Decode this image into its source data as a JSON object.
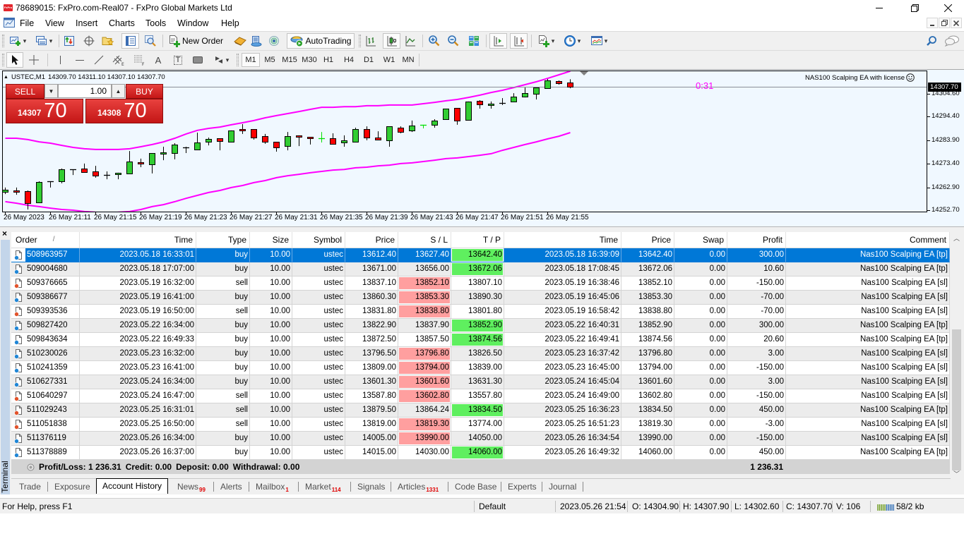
{
  "window": {
    "title": "78689015: FxPro.com-Real07 - FxPro Global Markets Ltd",
    "app_icon_text": "FxPro"
  },
  "menu": [
    "File",
    "View",
    "Insert",
    "Charts",
    "Tools",
    "Window",
    "Help"
  ],
  "toolbar": {
    "new_order": "New Order",
    "autotrading": "AutoTrading",
    "timeframes": [
      "M1",
      "M5",
      "M15",
      "M30",
      "H1",
      "H4",
      "D1",
      "W1",
      "MN"
    ],
    "active_timeframe": "M1",
    "drawing_text_tool": "A",
    "drawing_label_tool": "T"
  },
  "chart": {
    "symbol_header": "USTEC,M1",
    "ohlc_header": "14309.70 14311.10 14307.10 14307.70",
    "ea_label": "NAS100 Scalping EA with license",
    "ea_status_icon": "smiley-icon",
    "bar_timer": "0:31",
    "bid": 14307.7,
    "bid_label": "14307.70",
    "price_range": [
      14252.07,
      14314.68
    ],
    "price_ticks": [
      "14304.60",
      "14294.40",
      "14283.90",
      "14273.40",
      "14262.90",
      "14252.70"
    ],
    "time_label_every": 4,
    "time_labels": [
      "26 May 2023",
      "26 May 21:11",
      "26 May 21:15",
      "26 May 21:19",
      "26 May 21:23",
      "26 May 21:27",
      "26 May 21:31",
      "26 May 21:35",
      "26 May 21:39",
      "26 May 21:43",
      "26 May 21:47",
      "26 May 21:51",
      "26 May 21:55"
    ],
    "colors": {
      "bull": "#32cd32",
      "bear": "#ff0000",
      "doji_up": "#00e000",
      "band": "#ff00ff",
      "bid_line": "#8a8f96"
    },
    "candles": [
      [
        14260.9,
        14262.8,
        14259.9,
        14261.8
      ],
      [
        14261.5,
        14262.8,
        14259.6,
        14260.9
      ],
      [
        14261.2,
        14261.5,
        14253.0,
        14255.9
      ],
      [
        14256.2,
        14265.6,
        14255.9,
        14265.3
      ],
      [
        14265.6,
        14265.6,
        14262.8,
        14265.6
      ],
      [
        14265.6,
        14271.3,
        14264.7,
        14270.9
      ],
      [
        14270.9,
        14270.9,
        14268.4,
        14270.9
      ],
      [
        14271.3,
        14273.5,
        14269.4,
        14269.7
      ],
      [
        14270.0,
        14272.5,
        14267.2,
        14268.1
      ],
      [
        14268.4,
        14270.0,
        14266.5,
        14268.4
      ],
      [
        14268.7,
        14269.4,
        14266.5,
        14269.4
      ],
      [
        14269.1,
        14279.1,
        14269.1,
        14274.4
      ],
      [
        14274.1,
        14275.7,
        14271.9,
        14273.5
      ],
      [
        14273.2,
        14278.2,
        14269.1,
        14278.2
      ],
      [
        14277.9,
        14281.0,
        14275.0,
        14278.5
      ],
      [
        14278.2,
        14282.6,
        14275.4,
        14282.0
      ],
      [
        14280.7,
        14281.0,
        14278.2,
        14280.7
      ],
      [
        14279.8,
        14287.3,
        14279.8,
        14282.9
      ],
      [
        14283.2,
        14285.1,
        14281.6,
        14284.5
      ],
      [
        14284.8,
        14284.8,
        14279.4,
        14283.5
      ],
      [
        14283.2,
        14288.3,
        14283.2,
        14288.3
      ],
      [
        14288.9,
        14291.1,
        14286.7,
        14288.3
      ],
      [
        14288.9,
        14288.9,
        14284.2,
        14285.1
      ],
      [
        14285.7,
        14286.7,
        14282.3,
        14283.2
      ],
      [
        14283.2,
        14283.2,
        14278.8,
        14280.7
      ],
      [
        14281.3,
        14287.6,
        14279.4,
        14285.7
      ],
      [
        14286.1,
        14286.1,
        14281.3,
        14285.4
      ],
      [
        14285.4,
        14285.4,
        14282.0,
        14284.8
      ],
      [
        14284.7,
        14287.6,
        14282.9,
        14284.7,
        "g"
      ],
      [
        14284.8,
        14287.0,
        14282.3,
        14282.3
      ],
      [
        14282.9,
        14286.1,
        14281.0,
        14283.9
      ],
      [
        14283.2,
        14289.5,
        14282.9,
        14288.9
      ],
      [
        14288.9,
        14290.1,
        14283.9,
        14285.1
      ],
      [
        14285.1,
        14287.9,
        14284.2,
        14284.2
      ],
      [
        14283.9,
        14290.1,
        14281.0,
        14290.1
      ],
      [
        14289.5,
        14290.1,
        14287.0,
        14287.6
      ],
      [
        14288.3,
        14292.7,
        14287.6,
        14290.5
      ],
      [
        14290.8,
        14290.8,
        14289.2,
        14290.8,
        "g"
      ],
      [
        14290.8,
        14293.3,
        14289.5,
        14292.7
      ],
      [
        14293.3,
        14298.0,
        14293.0,
        14298.0
      ],
      [
        14298.3,
        14298.3,
        14290.8,
        14292.7
      ],
      [
        14293.0,
        14301.2,
        14292.7,
        14301.2
      ],
      [
        14301.5,
        14301.8,
        14298.0,
        14299.9
      ],
      [
        14299.6,
        14301.2,
        14298.0,
        14300.2
      ],
      [
        14300.5,
        14302.7,
        14299.6,
        14300.5
      ],
      [
        14301.2,
        14304.9,
        14301.2,
        14303.4
      ],
      [
        14303.4,
        14307.4,
        14303.0,
        14304.9
      ],
      [
        14304.6,
        14307.4,
        14302.1,
        14307.4
      ],
      [
        14307.1,
        14311.2,
        14306.8,
        14310.6
      ],
      [
        14310.3,
        14310.6,
        14308.7,
        14309.3
      ],
      [
        14309.7,
        14311.1,
        14307.1,
        14307.7
      ]
    ],
    "bands": {
      "upper": [
        14284.8,
        14284.8,
        14284.2,
        14283.2,
        14282.6,
        14281.6,
        14280.7,
        14280.1,
        14279.8,
        14279.8,
        14279.8,
        14280.1,
        14281.0,
        14282.0,
        14283.2,
        14284.8,
        14286.7,
        14288.3,
        14289.2,
        14289.8,
        14290.8,
        14291.7,
        14292.7,
        14293.9,
        14294.9,
        14295.8,
        14296.7,
        14297.7,
        14298.6,
        14298.6,
        14298.9,
        14298.9,
        14299.3,
        14299.3,
        14299.6,
        14299.6,
        14299.6,
        14300.2,
        14300.8,
        14301.5,
        14302.1,
        14303.0,
        14304.0,
        14305.2,
        14306.2,
        14307.4,
        14308.7,
        14310.0,
        14311.5,
        14313.1,
        14314.7
      ],
      "lower": [
        14256.5,
        14255.8,
        14254.9,
        14254.3,
        14253.6,
        14253.0,
        14252.7,
        14252.1,
        14251.8,
        14251.4,
        14251.8,
        14252.1,
        14253.0,
        14254.3,
        14255.2,
        14256.5,
        14258.0,
        14259.3,
        14260.6,
        14261.5,
        14262.8,
        14263.7,
        14265.0,
        14265.9,
        14267.2,
        14268.1,
        14268.7,
        14269.4,
        14270.0,
        14270.6,
        14270.9,
        14271.6,
        14271.9,
        14272.5,
        14272.8,
        14273.5,
        14273.8,
        14274.4,
        14275.0,
        14275.7,
        14276.0,
        14276.6,
        14277.2,
        14277.9,
        14279.4,
        14280.7,
        14282.0,
        14283.2,
        14284.5,
        14285.7,
        14287.3
      ]
    }
  },
  "one_click": {
    "sell_label": "SELL",
    "buy_label": "BUY",
    "lot": "1.00",
    "sell_price_main": "14307",
    "sell_price_big": "70",
    "buy_price_main": "14308",
    "buy_price_big": "70"
  },
  "terminal": {
    "label": "Terminal",
    "close": "×",
    "sort_indicator": "/",
    "columns": [
      {
        "key": "order",
        "label": "Order"
      },
      {
        "key": "open_time",
        "label": "Time"
      },
      {
        "key": "type",
        "label": "Type"
      },
      {
        "key": "size",
        "label": "Size"
      },
      {
        "key": "symbol",
        "label": "Symbol"
      },
      {
        "key": "open_price",
        "label": "Price"
      },
      {
        "key": "sl",
        "label": "S / L"
      },
      {
        "key": "tp",
        "label": "T / P"
      },
      {
        "key": "close_time",
        "label": "Time"
      },
      {
        "key": "close_price",
        "label": "Price"
      },
      {
        "key": "swap",
        "label": "Swap"
      },
      {
        "key": "profit",
        "label": "Profit"
      },
      {
        "key": "comment",
        "label": "Comment"
      }
    ],
    "rows": [
      {
        "order": "508963957",
        "open_time": "2023.05.18 16:33:01",
        "type": "buy",
        "size": "10.00",
        "symbol": "ustec",
        "open_price": "13612.40",
        "sl": "13627.40",
        "tp": "13642.40",
        "close_time": "2023.05.18 16:39:09",
        "close_price": "13642.40",
        "swap": "0.00",
        "profit": "300.00",
        "comment": "Nas100 Scalping EA [tp]",
        "hit": "tp",
        "selected": true
      },
      {
        "order": "509004680",
        "open_time": "2023.05.18 17:07:00",
        "type": "buy",
        "size": "10.00",
        "symbol": "ustec",
        "open_price": "13671.00",
        "sl": "13656.00",
        "tp": "13672.06",
        "close_time": "2023.05.18 17:08:45",
        "close_price": "13672.06",
        "swap": "0.00",
        "profit": "10.60",
        "comment": "Nas100 Scalping EA [tp]",
        "hit": "tp"
      },
      {
        "order": "509376665",
        "open_time": "2023.05.19 16:32:00",
        "type": "sell",
        "size": "10.00",
        "symbol": "ustec",
        "open_price": "13837.10",
        "sl": "13852.10",
        "tp": "13807.10",
        "close_time": "2023.05.19 16:38:46",
        "close_price": "13852.10",
        "swap": "0.00",
        "profit": "-150.00",
        "comment": "Nas100 Scalping EA [sl]",
        "hit": "sl"
      },
      {
        "order": "509386677",
        "open_time": "2023.05.19 16:41:00",
        "type": "buy",
        "size": "10.00",
        "symbol": "ustec",
        "open_price": "13860.30",
        "sl": "13853.30",
        "tp": "13890.30",
        "close_time": "2023.05.19 16:45:06",
        "close_price": "13853.30",
        "swap": "0.00",
        "profit": "-70.00",
        "comment": "Nas100 Scalping EA [sl]",
        "hit": "sl"
      },
      {
        "order": "509393536",
        "open_time": "2023.05.19 16:50:00",
        "type": "sell",
        "size": "10.00",
        "symbol": "ustec",
        "open_price": "13831.80",
        "sl": "13838.80",
        "tp": "13801.80",
        "close_time": "2023.05.19 16:58:42",
        "close_price": "13838.80",
        "swap": "0.00",
        "profit": "-70.00",
        "comment": "Nas100 Scalping EA [sl]",
        "hit": "sl"
      },
      {
        "order": "509827420",
        "open_time": "2023.05.22 16:34:00",
        "type": "buy",
        "size": "10.00",
        "symbol": "ustec",
        "open_price": "13822.90",
        "sl": "13837.90",
        "tp": "13852.90",
        "close_time": "2023.05.22 16:40:31",
        "close_price": "13852.90",
        "swap": "0.00",
        "profit": "300.00",
        "comment": "Nas100 Scalping EA [tp]",
        "hit": "tp"
      },
      {
        "order": "509843634",
        "open_time": "2023.05.22 16:49:33",
        "type": "buy",
        "size": "10.00",
        "symbol": "ustec",
        "open_price": "13872.50",
        "sl": "13857.50",
        "tp": "13874.56",
        "close_time": "2023.05.22 16:49:41",
        "close_price": "13874.56",
        "swap": "0.00",
        "profit": "20.60",
        "comment": "Nas100 Scalping EA [tp]",
        "hit": "tp"
      },
      {
        "order": "510230026",
        "open_time": "2023.05.23 16:32:00",
        "type": "buy",
        "size": "10.00",
        "symbol": "ustec",
        "open_price": "13796.50",
        "sl": "13796.80",
        "tp": "13826.50",
        "close_time": "2023.05.23 16:37:42",
        "close_price": "13796.80",
        "swap": "0.00",
        "profit": "3.00",
        "comment": "Nas100 Scalping EA [sl]",
        "hit": "sl"
      },
      {
        "order": "510241359",
        "open_time": "2023.05.23 16:41:00",
        "type": "buy",
        "size": "10.00",
        "symbol": "ustec",
        "open_price": "13809.00",
        "sl": "13794.00",
        "tp": "13839.00",
        "close_time": "2023.05.23 16:45:00",
        "close_price": "13794.00",
        "swap": "0.00",
        "profit": "-150.00",
        "comment": "Nas100 Scalping EA [sl]",
        "hit": "sl"
      },
      {
        "order": "510627331",
        "open_time": "2023.05.24 16:34:00",
        "type": "buy",
        "size": "10.00",
        "symbol": "ustec",
        "open_price": "13601.30",
        "sl": "13601.60",
        "tp": "13631.30",
        "close_time": "2023.05.24 16:45:04",
        "close_price": "13601.60",
        "swap": "0.00",
        "profit": "3.00",
        "comment": "Nas100 Scalping EA [sl]",
        "hit": "sl"
      },
      {
        "order": "510640297",
        "open_time": "2023.05.24 16:47:00",
        "type": "sell",
        "size": "10.00",
        "symbol": "ustec",
        "open_price": "13587.80",
        "sl": "13602.80",
        "tp": "13557.80",
        "close_time": "2023.05.24 16:49:00",
        "close_price": "13602.80",
        "swap": "0.00",
        "profit": "-150.00",
        "comment": "Nas100 Scalping EA [sl]",
        "hit": "sl"
      },
      {
        "order": "511029243",
        "open_time": "2023.05.25 16:31:01",
        "type": "sell",
        "size": "10.00",
        "symbol": "ustec",
        "open_price": "13879.50",
        "sl": "13864.24",
        "tp": "13834.50",
        "close_time": "2023.05.25 16:36:23",
        "close_price": "13834.50",
        "swap": "0.00",
        "profit": "450.00",
        "comment": "Nas100 Scalping EA [tp]",
        "hit": "tp"
      },
      {
        "order": "511051838",
        "open_time": "2023.05.25 16:50:00",
        "type": "sell",
        "size": "10.00",
        "symbol": "ustec",
        "open_price": "13819.00",
        "sl": "13819.30",
        "tp": "13774.00",
        "close_time": "2023.05.25 16:51:23",
        "close_price": "13819.30",
        "swap": "0.00",
        "profit": "-3.00",
        "comment": "Nas100 Scalping EA [sl]",
        "hit": "sl"
      },
      {
        "order": "511376119",
        "open_time": "2023.05.26 16:34:00",
        "type": "buy",
        "size": "10.00",
        "symbol": "ustec",
        "open_price": "14005.00",
        "sl": "13990.00",
        "tp": "14050.00",
        "close_time": "2023.05.26 16:34:54",
        "close_price": "13990.00",
        "swap": "0.00",
        "profit": "-150.00",
        "comment": "Nas100 Scalping EA [sl]",
        "hit": "sl"
      },
      {
        "order": "511378889",
        "open_time": "2023.05.26 16:37:00",
        "type": "buy",
        "size": "10.00",
        "symbol": "ustec",
        "open_price": "14015.00",
        "sl": "14030.00",
        "tp": "14060.00",
        "close_time": "2023.05.26 16:49:32",
        "close_price": "14060.00",
        "swap": "0.00",
        "profit": "450.00",
        "comment": "Nas100 Scalping EA [tp]",
        "hit": "tp"
      }
    ],
    "summary": {
      "profit_loss": "Profit/Loss: 1 236.31",
      "credit": "Credit: 0.00",
      "deposit": "Deposit: 0.00",
      "withdrawal": "Withdrawal: 0.00",
      "total": "1 236.31"
    },
    "tabs": [
      {
        "label": "Trade",
        "badge": ""
      },
      {
        "label": "Exposure",
        "badge": ""
      },
      {
        "label": "Account History",
        "badge": "",
        "active": true
      },
      {
        "label": "News",
        "badge": "99"
      },
      {
        "label": "Alerts",
        "badge": ""
      },
      {
        "label": "Mailbox",
        "badge": "1"
      },
      {
        "label": "Market",
        "badge": "114"
      },
      {
        "label": "Signals",
        "badge": ""
      },
      {
        "label": "Articles",
        "badge": "1331"
      },
      {
        "label": "Code Base",
        "badge": ""
      },
      {
        "label": "Experts",
        "badge": ""
      },
      {
        "label": "Journal",
        "badge": ""
      }
    ]
  },
  "status": {
    "help": "For Help, press F1",
    "profile": "Default",
    "datetime": "2023.05.26 21:54",
    "open": "O: 14304.90",
    "high": "H: 14307.90",
    "low": "L: 14302.60",
    "close": "C: 14307.70",
    "volume": "V: 106",
    "traffic": "58/2 kb"
  }
}
